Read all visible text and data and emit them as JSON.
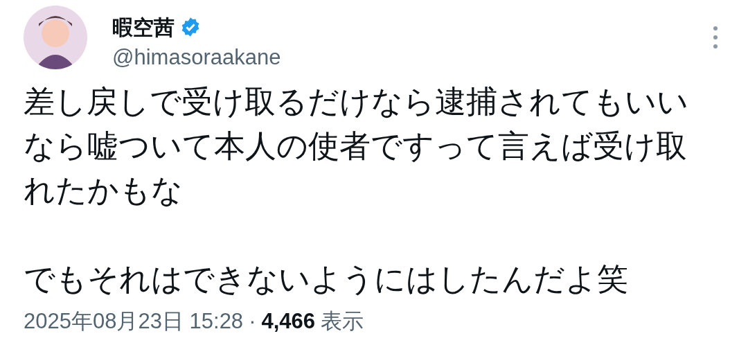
{
  "author": {
    "name": "暇空茜",
    "verified": true,
    "handle": "@himasoraakane"
  },
  "paragraphs": [
    "差し戻しで受け取るだけなら逮捕されてもいいなら嘘ついて本人の使者ですって言えば受け取れたかもな",
    "でもそれはできないようにはしたんだよ笑"
  ],
  "meta": {
    "timestamp": "2025年08月23日 15:28",
    "separator": "·",
    "views": "4,466",
    "views_label": "表示"
  }
}
